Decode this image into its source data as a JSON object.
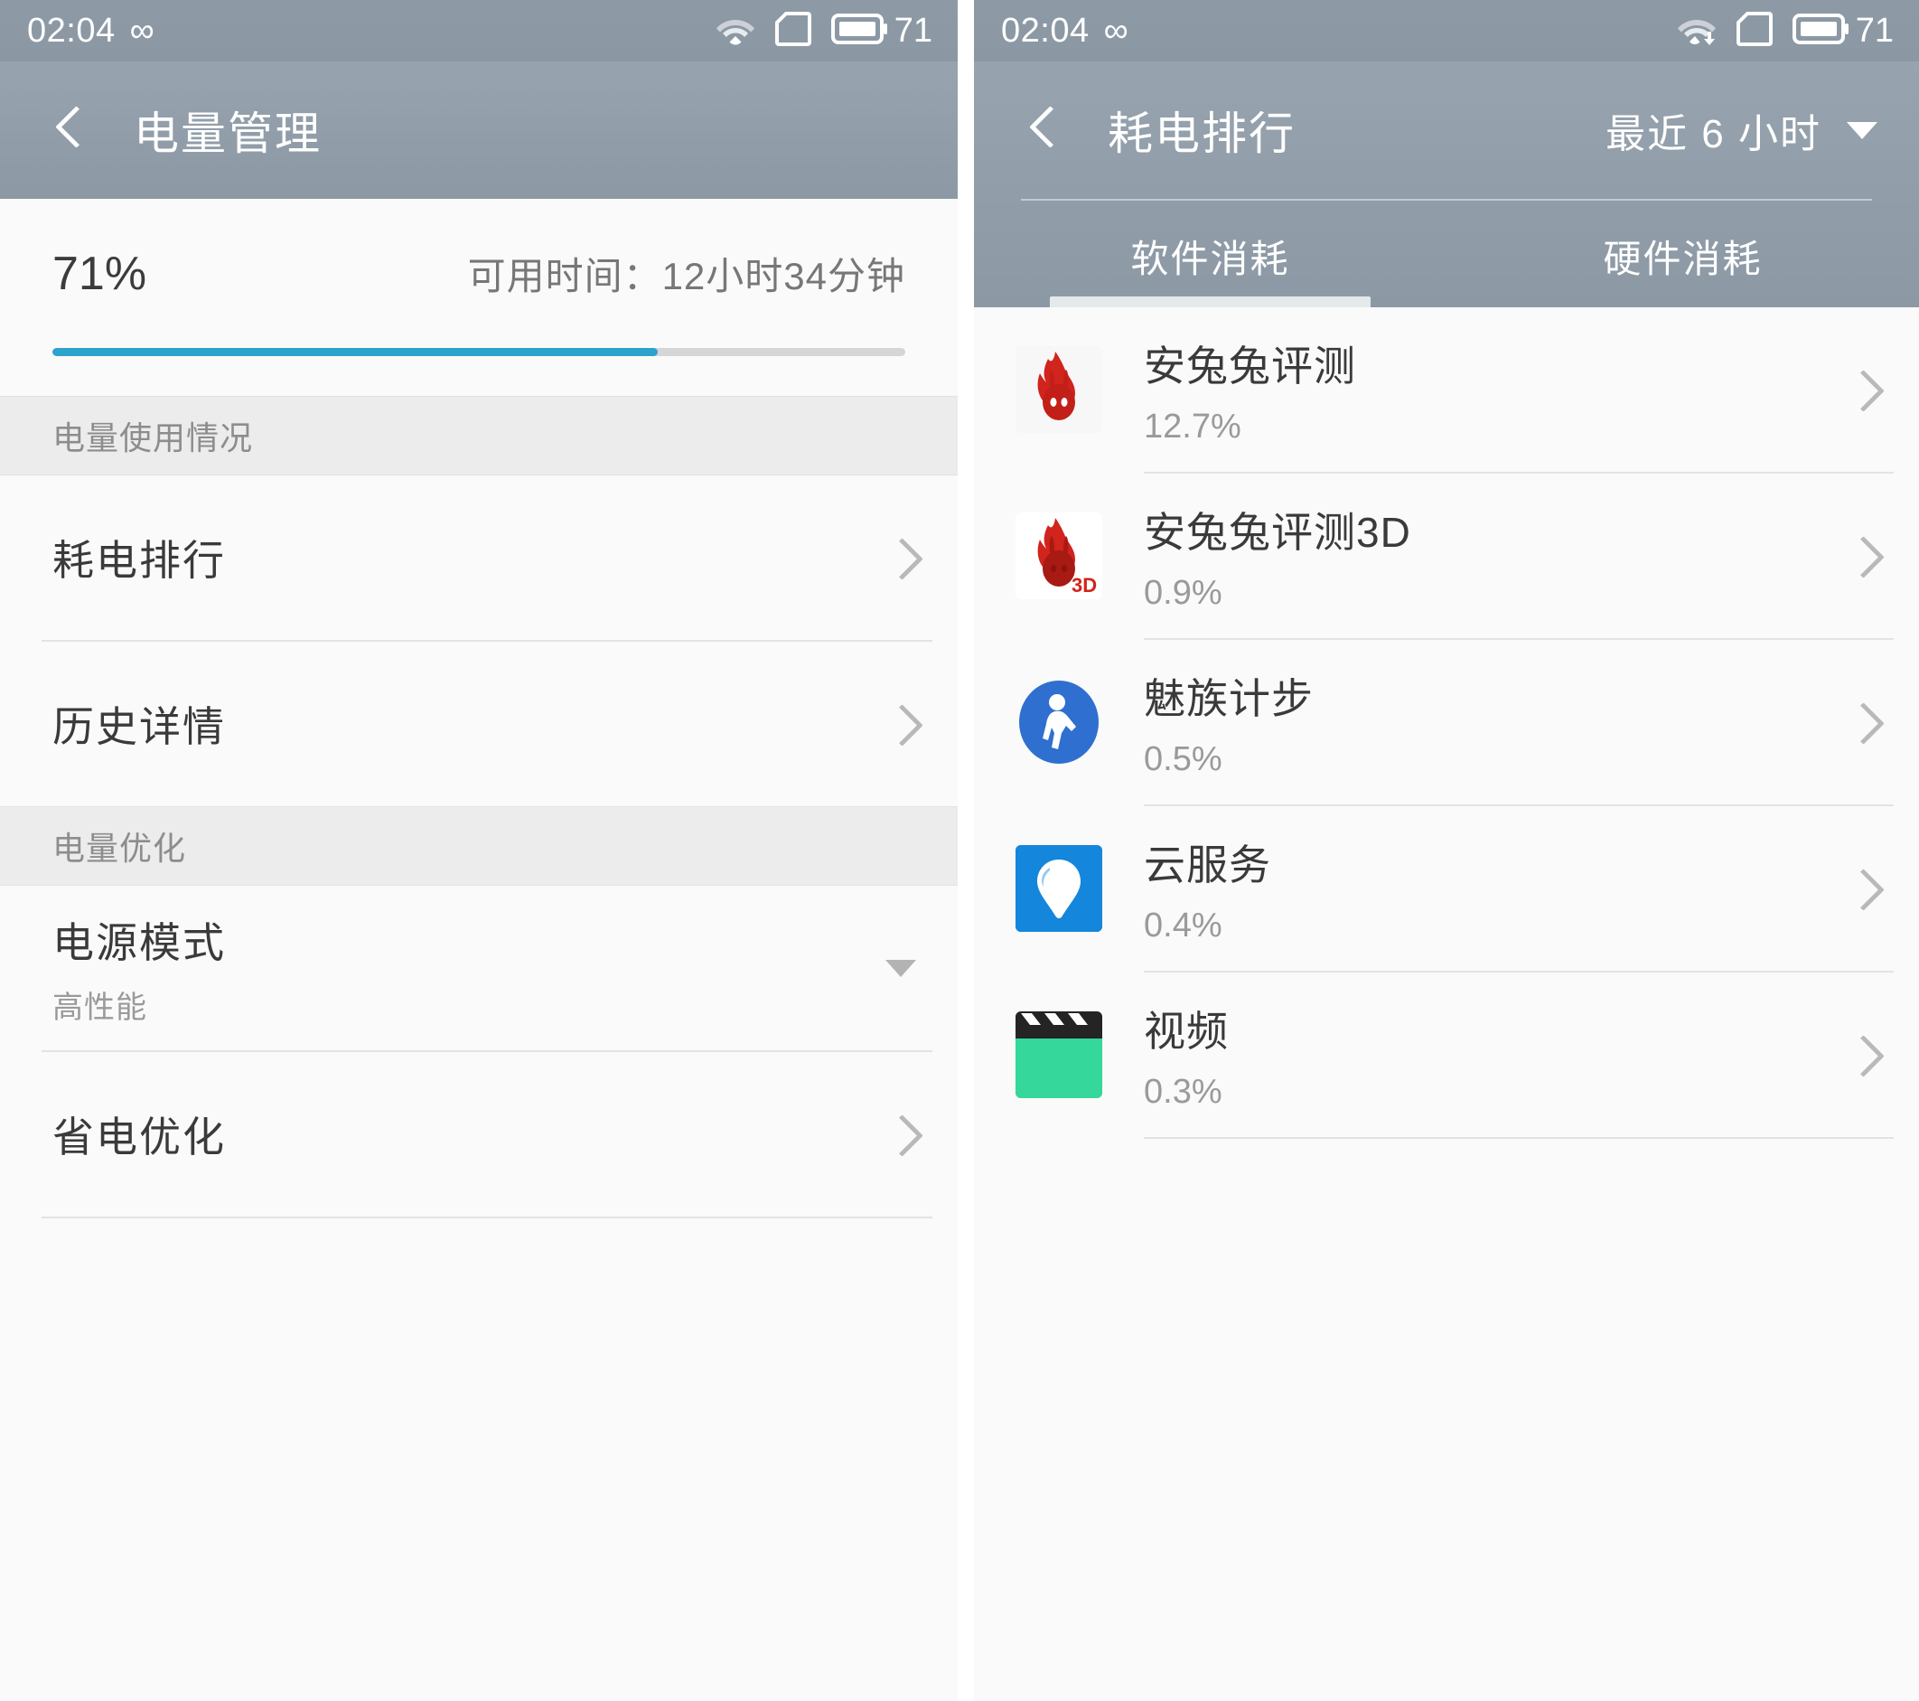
{
  "status_bar": {
    "time": "02:04",
    "infinity_glyph": "∞",
    "battery_level": "71",
    "icons": [
      "wifi-icon",
      "sim-card-icon",
      "battery-icon"
    ]
  },
  "left_screen": {
    "title": "电量管理",
    "back_icon": "back-chevron-icon",
    "battery": {
      "percent_label": "71%",
      "percent_value": 71,
      "remaining_label": "可用时间：12小时34分钟",
      "progress_color": "#2ca3cc"
    },
    "sections": [
      {
        "header": "电量使用情况",
        "items": [
          {
            "title": "耗电排行",
            "subtitle": "",
            "accessory": "chevron-right-icon"
          },
          {
            "title": "历史详情",
            "subtitle": "",
            "accessory": "chevron-right-icon"
          }
        ]
      },
      {
        "header": "电量优化",
        "items": [
          {
            "title": "电源模式",
            "subtitle": "高性能",
            "accessory": "caret-down-icon"
          },
          {
            "title": "省电优化",
            "subtitle": "",
            "accessory": "chevron-right-icon"
          }
        ]
      }
    ]
  },
  "right_screen": {
    "title": "耗电排行",
    "back_icon": "back-chevron-icon",
    "range_selector": {
      "label": "最近 6 小时",
      "caret_icon": "caret-down-icon"
    },
    "tabs": [
      {
        "label": "软件消耗",
        "active": true
      },
      {
        "label": "硬件消耗",
        "active": false
      }
    ],
    "apps": [
      {
        "name": "安兔兔评测",
        "percent": "12.7%",
        "icon": "antutu-icon",
        "accessory": "chevron-right-icon"
      },
      {
        "name": "安兔兔评测3D",
        "percent": "0.9%",
        "icon": "antutu-3d-icon",
        "accessory": "chevron-right-icon"
      },
      {
        "name": "魅族计步",
        "percent": "0.5%",
        "icon": "pedometer-icon",
        "accessory": "chevron-right-icon"
      },
      {
        "name": "云服务",
        "percent": "0.4%",
        "icon": "cloud-service-icon",
        "accessory": "chevron-right-icon"
      },
      {
        "name": "视频",
        "percent": "0.3%",
        "icon": "video-icon",
        "accessory": "chevron-right-icon"
      }
    ]
  },
  "colors": {
    "header_gradient_top": "#97a3ae",
    "header_gradient_bottom": "#8c99a5",
    "page_background": "#fafafa",
    "section_header_background": "#ececec",
    "accent_blue": "#2ca3cc",
    "pedometer_blue": "#2f6fd0",
    "cloud_blue": "#1486db",
    "video_green": "#35d79a",
    "antutu_red": "#d0241c"
  }
}
